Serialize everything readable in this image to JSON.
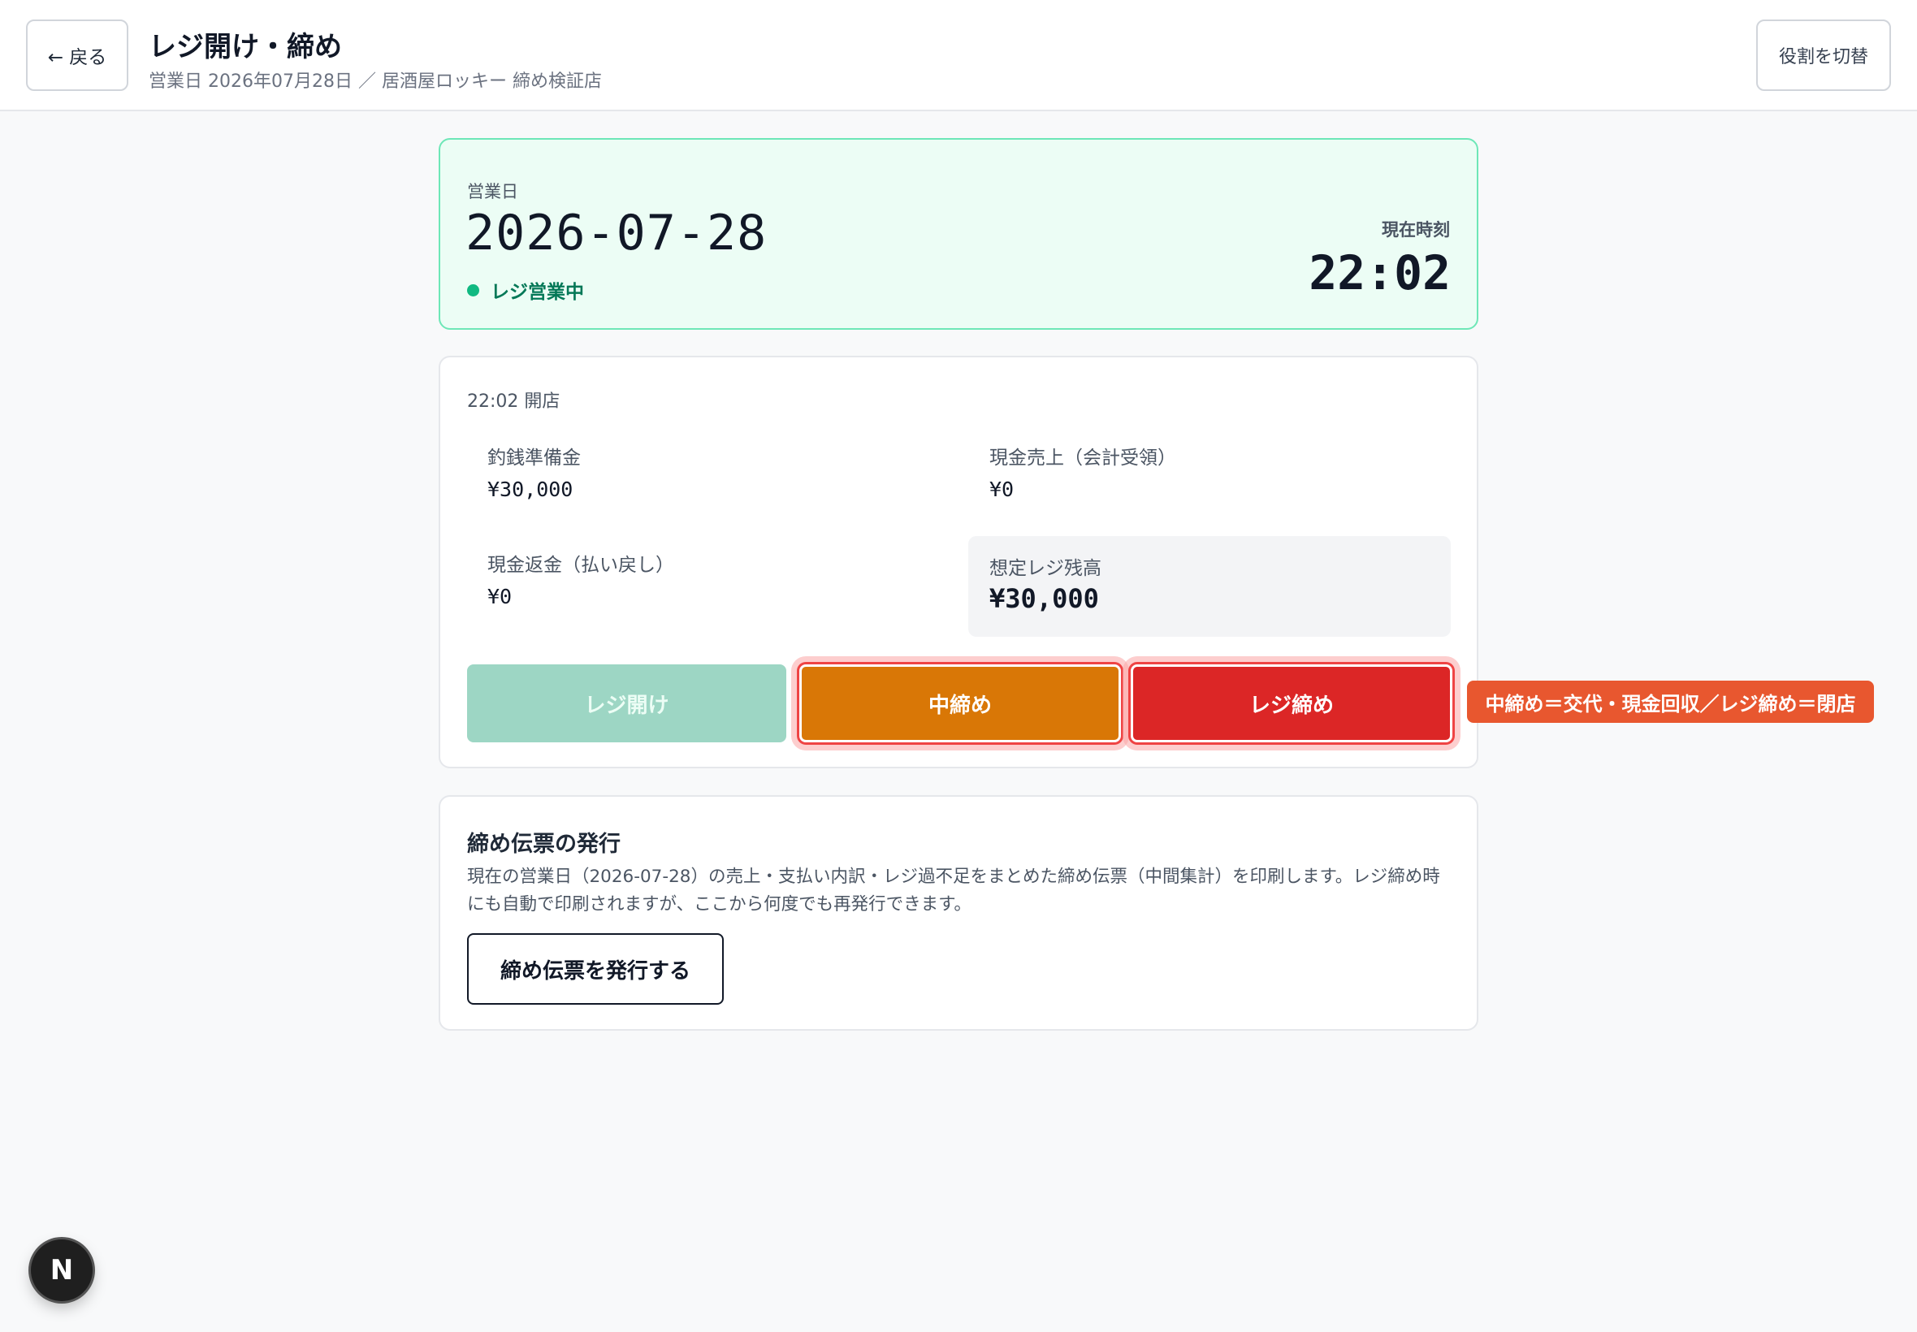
{
  "header": {
    "back_label": "← 戻る",
    "title": "レジ開け・締め",
    "subtitle": "営業日 2026年07月28日 ／ 居酒屋ロッキー 締め検証店",
    "role_switch_label": "役割を切替"
  },
  "status": {
    "business_day_label": "営業日",
    "business_day": "2026-07-28",
    "register_status": "レジ営業中",
    "current_time_label": "現在時刻",
    "current_time": "22:02",
    "status_color": "#10b981"
  },
  "register": {
    "opened_text": "22:02 開店",
    "float_label": "釣銭準備金",
    "float_value": "¥30,000",
    "cash_sales_label": "現金売上（会計受領）",
    "cash_sales_value": "¥0",
    "cash_refund_label": "現金返金（払い戻し）",
    "cash_refund_value": "¥0",
    "expected_balance_label": "想定レジ残高",
    "expected_balance_value": "¥30,000",
    "buttons": {
      "open": "レジ開け",
      "mid_close": "中締め",
      "close": "レジ締め"
    },
    "tooltip": "中締め＝交代・現金回収／レジ締め＝閉店"
  },
  "slip": {
    "title": "締め伝票の発行",
    "description": "現在の営業日（2026-07-28）の売上・支払い内訳・レジ過不足をまとめた締め伝票（中間集計）を印刷します。レジ締め時にも自動で印刷されますが、ここから何度でも再発行できます。",
    "button_label": "締め伝票を発行する"
  },
  "floating": {
    "badge_label": "N"
  },
  "colors": {
    "accent_green": "#10b981",
    "mid_close": "#d97706",
    "close": "#dc2626",
    "tooltip": "#e8572f"
  }
}
